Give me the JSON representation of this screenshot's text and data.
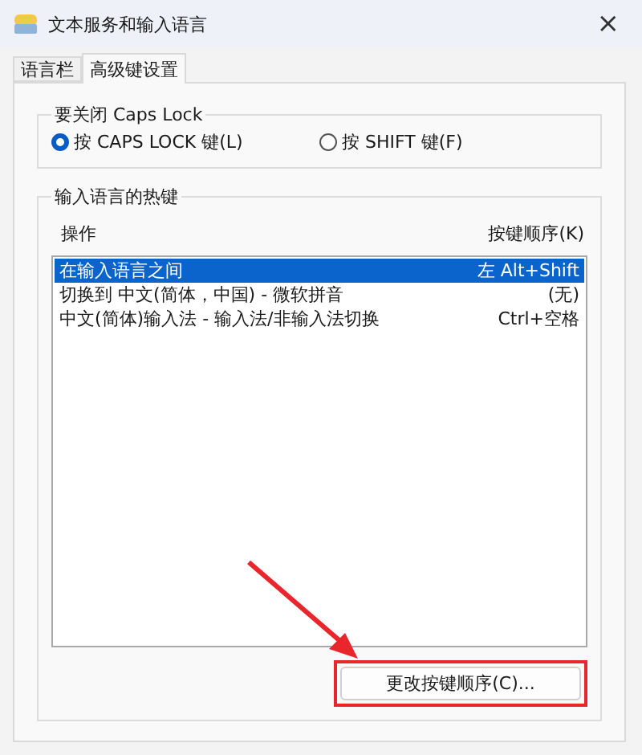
{
  "window": {
    "title": "文本服务和输入语言",
    "close": "×"
  },
  "tabs": [
    {
      "label": "语言栏",
      "selected": false
    },
    {
      "label": "高级键设置",
      "selected": true
    }
  ],
  "caps_lock_group": {
    "title": "要关闭 Caps Lock",
    "options": [
      {
        "label": "按 CAPS LOCK 键(L)",
        "selected": true
      },
      {
        "label": "按 SHIFT 键(F)",
        "selected": false
      }
    ]
  },
  "hotkeys_group": {
    "title": "输入语言的热键",
    "columns": [
      "操作",
      "按键顺序(K)"
    ],
    "rows": [
      {
        "action": "在输入语言之间",
        "keys": "左 Alt+Shift",
        "selected": true
      },
      {
        "action": "切换到 中文(简体，中国) - 微软拼音",
        "keys": "(无)",
        "selected": false
      },
      {
        "action": "中文(简体)输入法 - 输入法/非输入法切换",
        "keys": "Ctrl+空格",
        "selected": false
      }
    ],
    "button": "更改按键顺序(C)..."
  }
}
